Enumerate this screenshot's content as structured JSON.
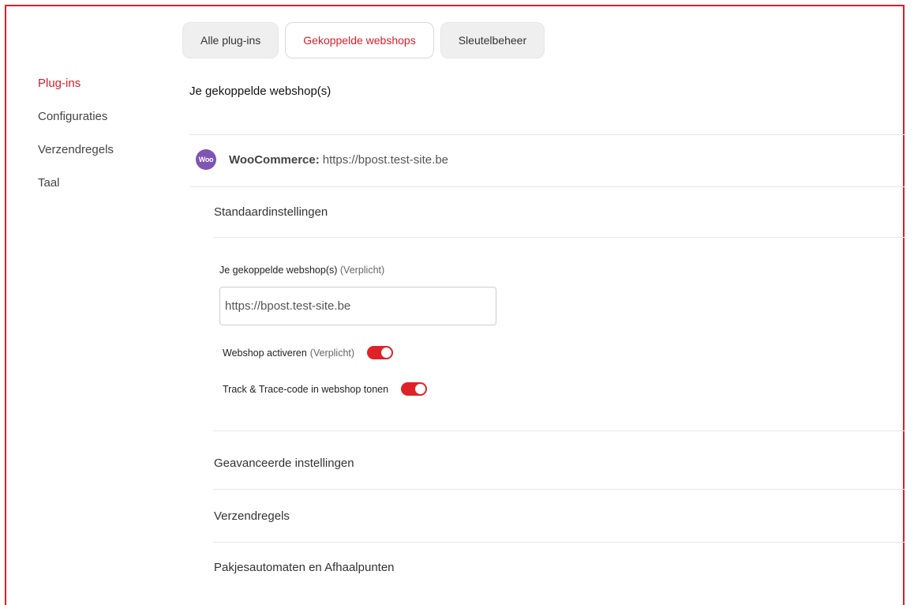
{
  "tabs": [
    {
      "label": "Alle plug-ins"
    },
    {
      "label": "Gekoppelde webshops"
    },
    {
      "label": "Sleutelbeheer"
    }
  ],
  "sidebar": {
    "items": [
      {
        "label": "Plug-ins"
      },
      {
        "label": "Configuraties"
      },
      {
        "label": "Verzendregels"
      },
      {
        "label": "Taal"
      }
    ]
  },
  "main": {
    "title": "Je gekoppelde webshop(s)",
    "shop": {
      "logo_text": "Woo",
      "platform": "WooCommerce:",
      "url": "https://bpost.test-site.be"
    },
    "default_settings": {
      "heading": "Standaardinstellingen",
      "field_label": "Je gekoppelde webshop(s)",
      "field_required": "(Verplicht)",
      "field_value": "https://bpost.test-site.be",
      "toggles": [
        {
          "label": "Webshop activeren",
          "required": "(Verplicht)",
          "on": true
        },
        {
          "label": "Track & Trace-code in webshop tonen",
          "required": "",
          "on": true
        }
      ]
    },
    "sections": [
      {
        "label": "Geavanceerde instellingen"
      },
      {
        "label": "Verzendregels"
      },
      {
        "label": "Pakjesautomaten en Afhaalpunten"
      }
    ]
  },
  "colors": {
    "accent": "#d81f2a",
    "toggle_on": "#e02128",
    "woo_purple": "#7f54b3"
  }
}
